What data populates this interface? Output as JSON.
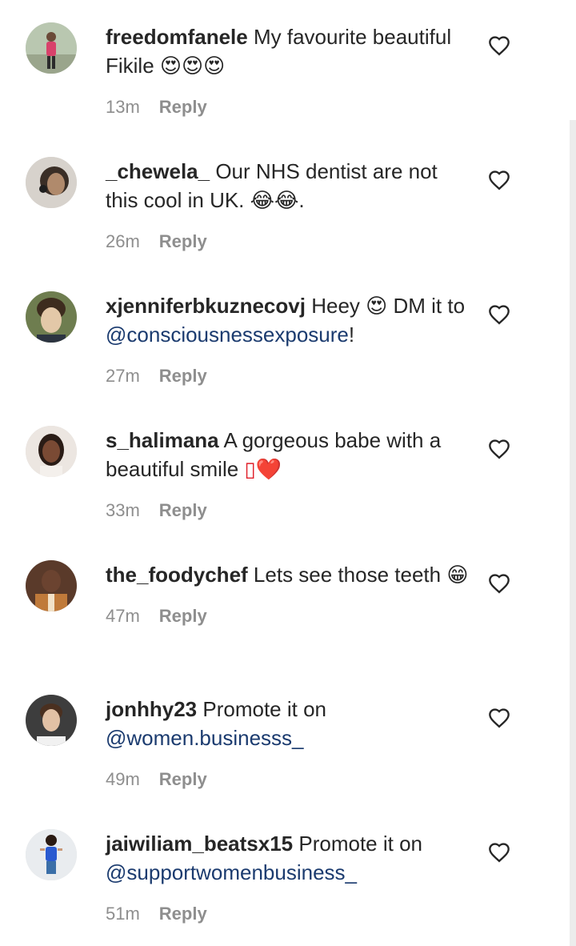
{
  "comments": [
    {
      "username": "freedomfanele",
      "text_before": "My favourite beautiful Fikile ",
      "mention": "",
      "text_after": "",
      "emoji": "😍😍😍",
      "time": "13m",
      "reply_label": "Reply",
      "avatar_bg": "#b9c7b0",
      "avatar_fg": "#d8426b"
    },
    {
      "username": "_chewela_",
      "text_before": "Our NHS dentist are not this cool in UK. ",
      "mention": "",
      "text_after": ".",
      "emoji": "😂😂",
      "time": "26m",
      "reply_label": "Reply",
      "avatar_bg": "#d7d2cc",
      "avatar_fg": "#6a5a4c"
    },
    {
      "username": "xjenniferbkuznecovj",
      "text_before": "Heey ",
      "emoji": "😍",
      "text_mid": " DM it to ",
      "mention": "@consciousnessexposure",
      "text_after": "!",
      "time": "27m",
      "reply_label": "Reply",
      "avatar_bg": "#6e7d4f",
      "avatar_fg": "#e3c8a8"
    },
    {
      "username": "s_halimana",
      "text_before": "A gorgeous babe with a beautiful smile ",
      "mention": "",
      "text_after": "",
      "emoji": "▯❤️",
      "time": "33m",
      "reply_label": "Reply",
      "avatar_bg": "#ece6e1",
      "avatar_fg": "#7a4a34"
    },
    {
      "username": "the_foodychef",
      "text_before": "Lets see those teeth ",
      "mention": "",
      "text_after": "",
      "emoji": "😁",
      "time": "47m",
      "reply_label": "Reply",
      "avatar_bg": "#5a3a2a",
      "avatar_fg": "#c07a3a"
    },
    {
      "username": "jonhhy23",
      "text_before": "Promote it on ",
      "mention": "@women.businesss_",
      "text_after": "",
      "emoji": "",
      "time": "49m",
      "reply_label": "Reply",
      "avatar_bg": "#3d3d3d",
      "avatar_fg": "#e2c1a5"
    },
    {
      "username": "jaiwiliam_beatsx15",
      "text_before": "Promote it on ",
      "mention": "@supportwomenbusiness_",
      "text_after": "",
      "emoji": "",
      "time": "51m",
      "reply_label": "Reply",
      "avatar_bg": "#e9ecef",
      "avatar_fg": "#2a5ad0"
    }
  ],
  "icons": {
    "like": "heart-outline-icon",
    "avatar": "profile-photo"
  },
  "colors": {
    "text": "#262626",
    "secondary": "#8e8e8e",
    "mention": "#1b3b6f"
  }
}
